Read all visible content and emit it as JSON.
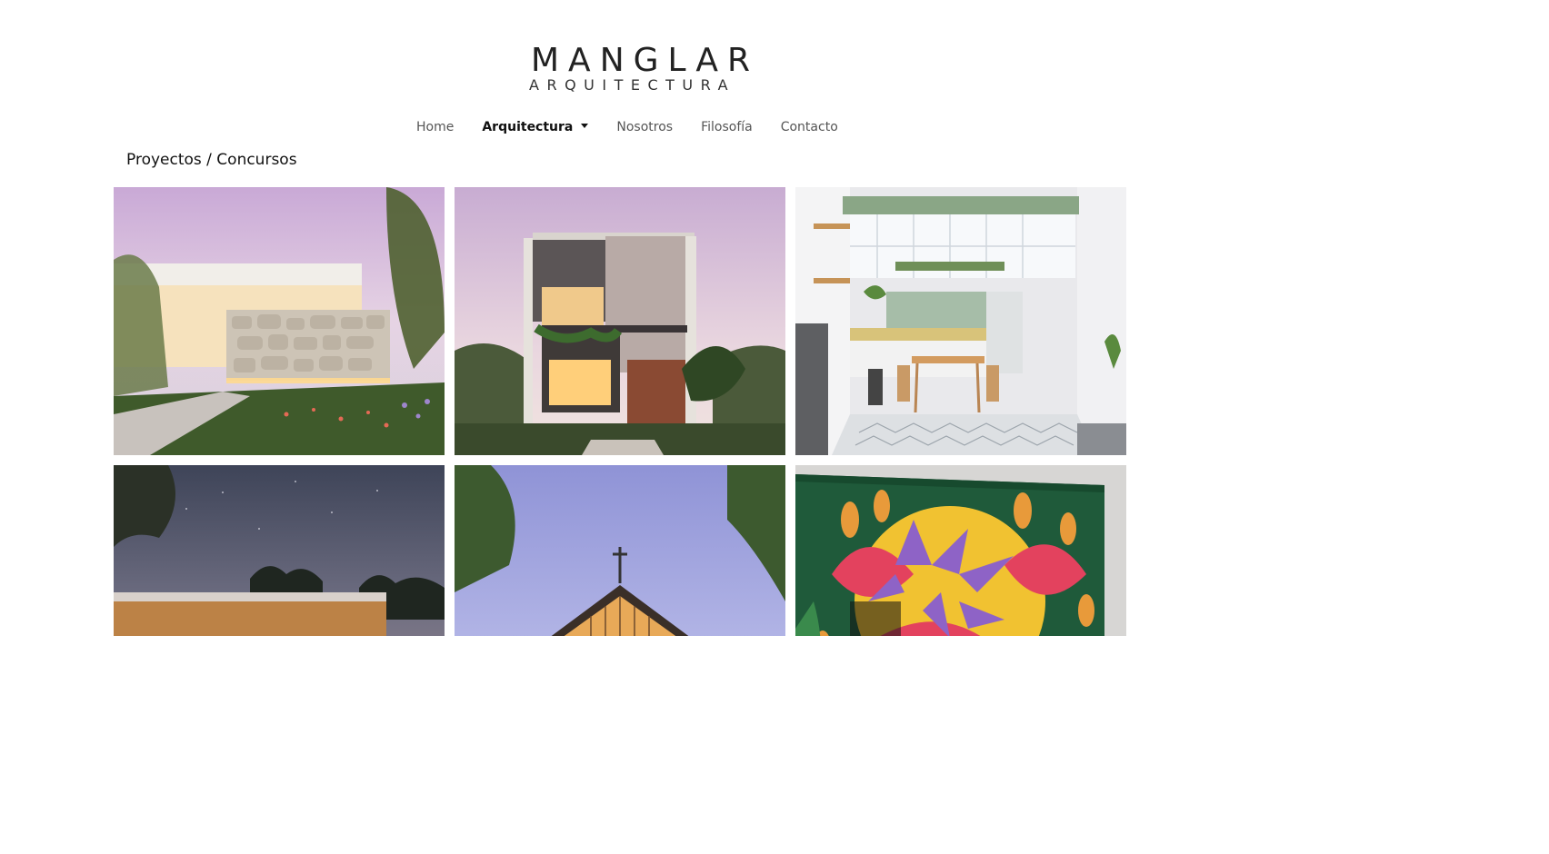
{
  "brand": {
    "name": "MANGLAR",
    "subtitle": "ARQUITECTURA"
  },
  "nav": {
    "items": [
      {
        "label": "Home",
        "active": false
      },
      {
        "label": "Arquitectura",
        "active": true,
        "dropdown": true
      },
      {
        "label": "Nosotros",
        "active": false
      },
      {
        "label": "Filosofía",
        "active": false
      },
      {
        "label": "Contacto",
        "active": false
      }
    ]
  },
  "breadcrumb": "Proyectos / Concursos",
  "gallery": {
    "tiles": [
      {
        "name": "project-tile-stone-house",
        "scene": "stone-house"
      },
      {
        "name": "project-tile-two-story-house",
        "scene": "two-story-house"
      },
      {
        "name": "project-tile-kitchen-interior",
        "scene": "kitchen"
      },
      {
        "name": "project-tile-night-pavilion",
        "scene": "night-pavilion"
      },
      {
        "name": "project-tile-chapel",
        "scene": "chapel"
      },
      {
        "name": "project-tile-flower-mural",
        "scene": "mural"
      }
    ]
  }
}
